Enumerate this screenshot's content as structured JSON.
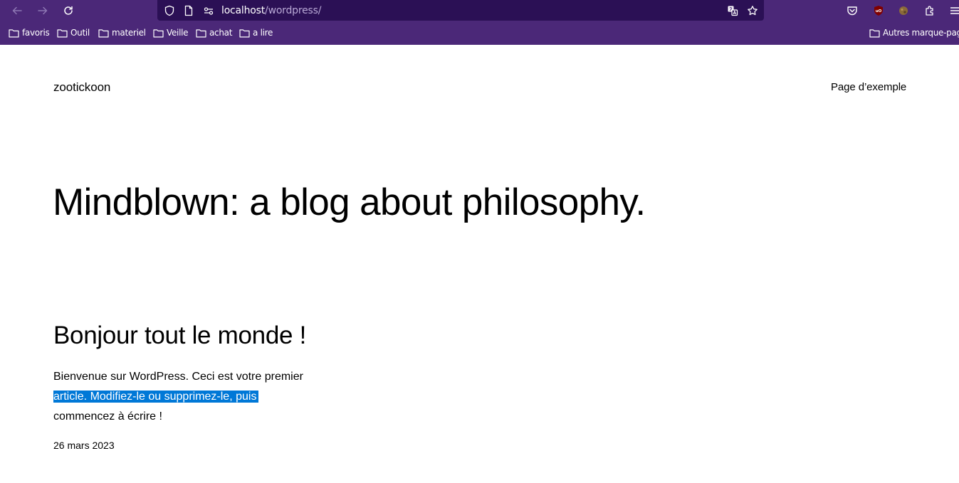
{
  "browser": {
    "url_host": "localhost",
    "url_path": "/wordpress/",
    "bookmarks": [
      {
        "label": "favoris"
      },
      {
        "label": "Outil"
      },
      {
        "label": "materiel"
      },
      {
        "label": "Veille"
      },
      {
        "label": "achat"
      },
      {
        "label": "a lire"
      }
    ],
    "other_bookmarks": "Autres marque-pages",
    "colors": {
      "chrome": "#4b2878",
      "urlbar": "#2b1055",
      "selection": "#0078d7"
    }
  },
  "site": {
    "title": "zootickoon",
    "nav_link": "Page d’exemple",
    "hero": "Mindblown: a blog about philosophy.",
    "post": {
      "title": "Bonjour tout le monde !",
      "excerpt_line1": "Bienvenue sur WordPress. Ceci est votre premier",
      "excerpt_line2": "article. Modifiez-le ou supprimez-le, puis",
      "excerpt_line3": "commencez à écrire !",
      "date": "26 mars 2023"
    }
  }
}
